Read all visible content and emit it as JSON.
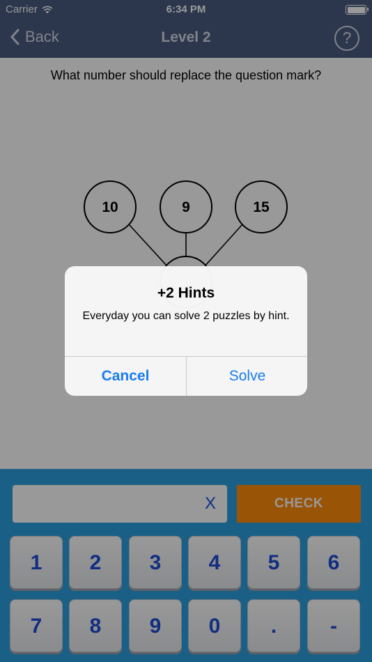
{
  "status_bar": {
    "carrier": "Carrier",
    "time": "6:34 PM",
    "wifi_icon": "wifi-icon",
    "battery_icon": "battery-icon"
  },
  "nav": {
    "back_label": "Back",
    "title": "Level 2",
    "help_icon": "question-mark-circle-icon",
    "help_glyph": "?"
  },
  "puzzle": {
    "question": "What number should replace the question mark?",
    "circles": [
      "10",
      "9",
      "15"
    ]
  },
  "input": {
    "value": "",
    "clear_label": "X"
  },
  "check_label": "CHECK",
  "keypad": {
    "keys": [
      "1",
      "2",
      "3",
      "4",
      "5",
      "6",
      "7",
      "8",
      "9",
      "0",
      ".",
      "-"
    ]
  },
  "alert": {
    "title": "+2 Hints",
    "message": "Everyday you can solve 2 puzzles by hint.",
    "cancel_label": "Cancel",
    "solve_label": "Solve"
  },
  "colors": {
    "nav_bar": "#4a5d80",
    "keypad_bg": "#2c9fe0",
    "check_button": "#ff8c0a",
    "key_text": "#1f4ed8",
    "alert_button_text": "#1a7cf0"
  }
}
